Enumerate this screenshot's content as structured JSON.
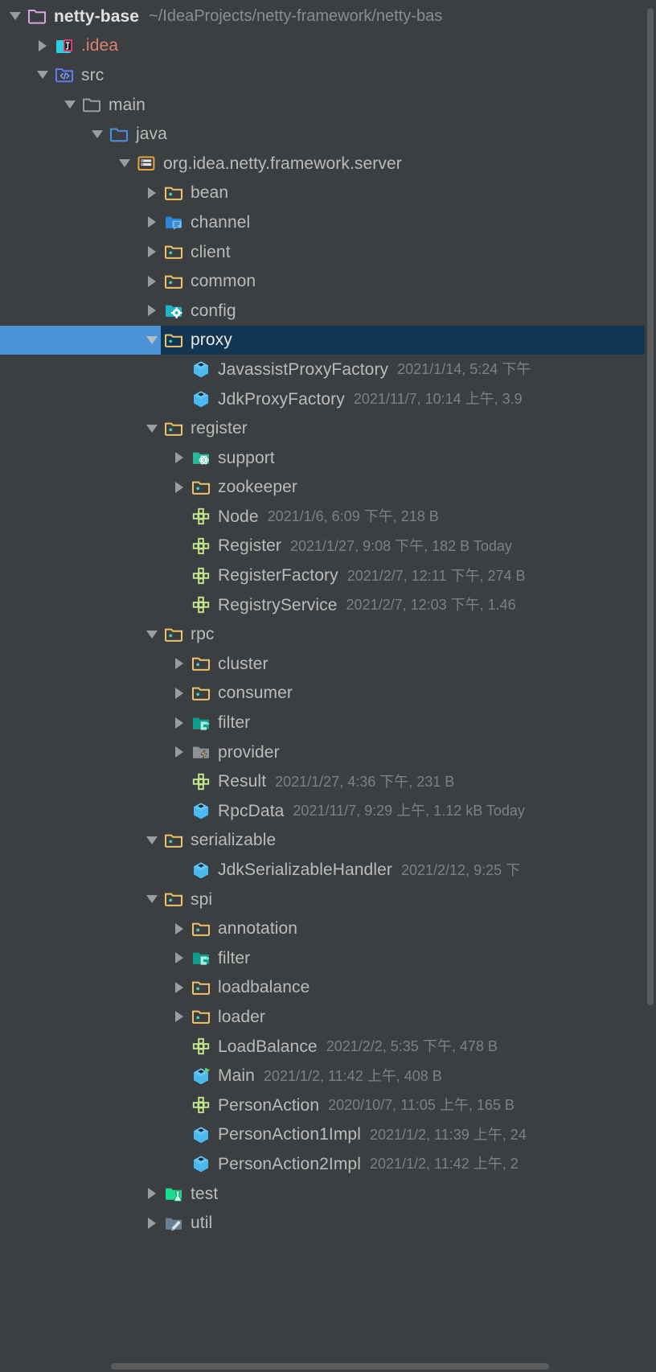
{
  "window": {
    "title": "Project",
    "background_color": "#3c3f41",
    "selection_color": "#4b91d6",
    "selection_row_color": "#123551",
    "text_color": "#bbbbbb",
    "meta_color": "#7d8184"
  },
  "tree": {
    "rows": [
      {
        "label": "netty-base",
        "meta": "",
        "path": "~/IdeaProjects/netty-framework/netty-bas",
        "depth": 0,
        "toggle": "down",
        "icon": "module-folder-icon",
        "style": "bold",
        "selected": false
      },
      {
        "label": ".idea",
        "meta": "",
        "path": "",
        "depth": 1,
        "toggle": "right",
        "icon": "idea-folder-icon",
        "style": "idea-orange",
        "selected": false
      },
      {
        "label": "src",
        "meta": "",
        "path": "",
        "depth": 1,
        "toggle": "down",
        "icon": "source-root-folder-icon",
        "style": "normal",
        "selected": false
      },
      {
        "label": "main",
        "meta": "",
        "path": "",
        "depth": 2,
        "toggle": "down",
        "icon": "plain-folder-icon",
        "style": "normal",
        "selected": false
      },
      {
        "label": "java",
        "meta": "",
        "path": "",
        "depth": 3,
        "toggle": "down",
        "icon": "blue-folder-icon",
        "style": "normal",
        "selected": false
      },
      {
        "label": "org.idea.netty.framework.server",
        "meta": "",
        "path": "",
        "depth": 4,
        "toggle": "down",
        "icon": "package-icon",
        "style": "normal",
        "selected": false
      },
      {
        "label": "bean",
        "meta": "",
        "path": "",
        "depth": 5,
        "toggle": "right",
        "icon": "package-folder-icon",
        "style": "normal",
        "selected": false
      },
      {
        "label": "channel",
        "meta": "",
        "path": "",
        "depth": 5,
        "toggle": "right",
        "icon": "channel-folder-icon",
        "style": "normal",
        "selected": false
      },
      {
        "label": "client",
        "meta": "",
        "path": "",
        "depth": 5,
        "toggle": "right",
        "icon": "package-folder-icon",
        "style": "normal",
        "selected": false
      },
      {
        "label": "common",
        "meta": "",
        "path": "",
        "depth": 5,
        "toggle": "right",
        "icon": "package-folder-icon",
        "style": "normal",
        "selected": false
      },
      {
        "label": "config",
        "meta": "",
        "path": "",
        "depth": 5,
        "toggle": "right",
        "icon": "config-folder-icon",
        "style": "normal",
        "selected": false
      },
      {
        "label": "proxy",
        "meta": "",
        "path": "",
        "depth": 5,
        "toggle": "down",
        "icon": "package-folder-icon",
        "style": "normal",
        "selected": true
      },
      {
        "label": "JavassistProxyFactory",
        "meta": "2021/1/14, 5:24 下午",
        "path": "",
        "depth": 6,
        "toggle": "none",
        "icon": "java-class-icon",
        "style": "normal",
        "selected": false
      },
      {
        "label": "JdkProxyFactory",
        "meta": "2021/11/7, 10:14 上午, 3.9",
        "path": "",
        "depth": 6,
        "toggle": "none",
        "icon": "java-class-icon",
        "style": "normal",
        "selected": false
      },
      {
        "label": "register",
        "meta": "",
        "path": "",
        "depth": 5,
        "toggle": "down",
        "icon": "package-folder-icon",
        "style": "normal",
        "selected": false
      },
      {
        "label": "support",
        "meta": "",
        "path": "",
        "depth": 6,
        "toggle": "right",
        "icon": "support-folder-icon",
        "style": "normal",
        "selected": false
      },
      {
        "label": "zookeeper",
        "meta": "",
        "path": "",
        "depth": 6,
        "toggle": "right",
        "icon": "package-folder-icon",
        "style": "normal",
        "selected": false
      },
      {
        "label": "Node",
        "meta": "2021/1/6, 6:09 下午, 218 B",
        "path": "",
        "depth": 6,
        "toggle": "none",
        "icon": "java-interface-icon",
        "style": "normal",
        "selected": false
      },
      {
        "label": "Register",
        "meta": "2021/1/27, 9:08 下午, 182 B Today",
        "path": "",
        "depth": 6,
        "toggle": "none",
        "icon": "java-interface-icon",
        "style": "normal",
        "selected": false
      },
      {
        "label": "RegisterFactory",
        "meta": "2021/2/7, 12:11 下午, 274 B",
        "path": "",
        "depth": 6,
        "toggle": "none",
        "icon": "java-interface-icon",
        "style": "normal",
        "selected": false
      },
      {
        "label": "RegistryService",
        "meta": "2021/2/7, 12:03 下午, 1.46",
        "path": "",
        "depth": 6,
        "toggle": "none",
        "icon": "java-interface-icon",
        "style": "normal",
        "selected": false
      },
      {
        "label": "rpc",
        "meta": "",
        "path": "",
        "depth": 5,
        "toggle": "down",
        "icon": "package-folder-icon",
        "style": "normal",
        "selected": false
      },
      {
        "label": "cluster",
        "meta": "",
        "path": "",
        "depth": 6,
        "toggle": "right",
        "icon": "package-folder-icon",
        "style": "normal",
        "selected": false
      },
      {
        "label": "consumer",
        "meta": "",
        "path": "",
        "depth": 6,
        "toggle": "right",
        "icon": "package-folder-icon",
        "style": "normal",
        "selected": false
      },
      {
        "label": "filter",
        "meta": "",
        "path": "",
        "depth": 6,
        "toggle": "right",
        "icon": "filter-folder-icon",
        "style": "normal",
        "selected": false
      },
      {
        "label": "provider",
        "meta": "",
        "path": "",
        "depth": 6,
        "toggle": "right",
        "icon": "provider-folder-icon",
        "style": "normal",
        "selected": false
      },
      {
        "label": "Result",
        "meta": "2021/1/27, 4:36 下午, 231 B",
        "path": "",
        "depth": 6,
        "toggle": "none",
        "icon": "java-interface-icon",
        "style": "normal",
        "selected": false
      },
      {
        "label": "RpcData",
        "meta": "2021/11/7, 9:29 上午, 1.12 kB Today",
        "path": "",
        "depth": 6,
        "toggle": "none",
        "icon": "java-class-icon",
        "style": "normal",
        "selected": false
      },
      {
        "label": "serializable",
        "meta": "",
        "path": "",
        "depth": 5,
        "toggle": "down",
        "icon": "package-folder-icon",
        "style": "normal",
        "selected": false
      },
      {
        "label": "JdkSerializableHandler",
        "meta": "2021/2/12, 9:25 下",
        "path": "",
        "depth": 6,
        "toggle": "none",
        "icon": "java-class-icon",
        "style": "normal",
        "selected": false
      },
      {
        "label": "spi",
        "meta": "",
        "path": "",
        "depth": 5,
        "toggle": "down",
        "icon": "package-folder-icon",
        "style": "normal",
        "selected": false
      },
      {
        "label": "annotation",
        "meta": "",
        "path": "",
        "depth": 6,
        "toggle": "right",
        "icon": "package-folder-icon",
        "style": "normal",
        "selected": false
      },
      {
        "label": "filter",
        "meta": "",
        "path": "",
        "depth": 6,
        "toggle": "right",
        "icon": "filter-folder-icon",
        "style": "normal",
        "selected": false
      },
      {
        "label": "loadbalance",
        "meta": "",
        "path": "",
        "depth": 6,
        "toggle": "right",
        "icon": "package-folder-icon",
        "style": "normal",
        "selected": false
      },
      {
        "label": "loader",
        "meta": "",
        "path": "",
        "depth": 6,
        "toggle": "right",
        "icon": "package-folder-icon",
        "style": "normal",
        "selected": false
      },
      {
        "label": "LoadBalance",
        "meta": "2021/2/2, 5:35 下午, 478 B",
        "path": "",
        "depth": 6,
        "toggle": "none",
        "icon": "java-interface-icon",
        "style": "normal",
        "selected": false
      },
      {
        "label": "Main",
        "meta": "2021/1/2, 11:42 上午, 408 B",
        "path": "",
        "depth": 6,
        "toggle": "none",
        "icon": "java-runnable-class-icon",
        "style": "normal",
        "selected": false
      },
      {
        "label": "PersonAction",
        "meta": "2020/10/7, 11:05 上午, 165 B",
        "path": "",
        "depth": 6,
        "toggle": "none",
        "icon": "java-interface-icon",
        "style": "normal",
        "selected": false
      },
      {
        "label": "PersonAction1Impl",
        "meta": "2021/1/2, 11:39 上午, 24",
        "path": "",
        "depth": 6,
        "toggle": "none",
        "icon": "java-class-icon",
        "style": "normal",
        "selected": false
      },
      {
        "label": "PersonAction2Impl",
        "meta": "2021/1/2, 11:42 上午, 2",
        "path": "",
        "depth": 6,
        "toggle": "none",
        "icon": "java-class-icon",
        "style": "normal",
        "selected": false
      },
      {
        "label": "test",
        "meta": "",
        "path": "",
        "depth": 5,
        "toggle": "right",
        "icon": "test-folder-icon",
        "style": "normal",
        "selected": false
      },
      {
        "label": "util",
        "meta": "",
        "path": "",
        "depth": 5,
        "toggle": "right",
        "icon": "util-folder-icon",
        "style": "normal",
        "selected": false
      }
    ]
  },
  "scrollbars": {
    "vertical_visible": true,
    "horizontal_visible": true
  }
}
